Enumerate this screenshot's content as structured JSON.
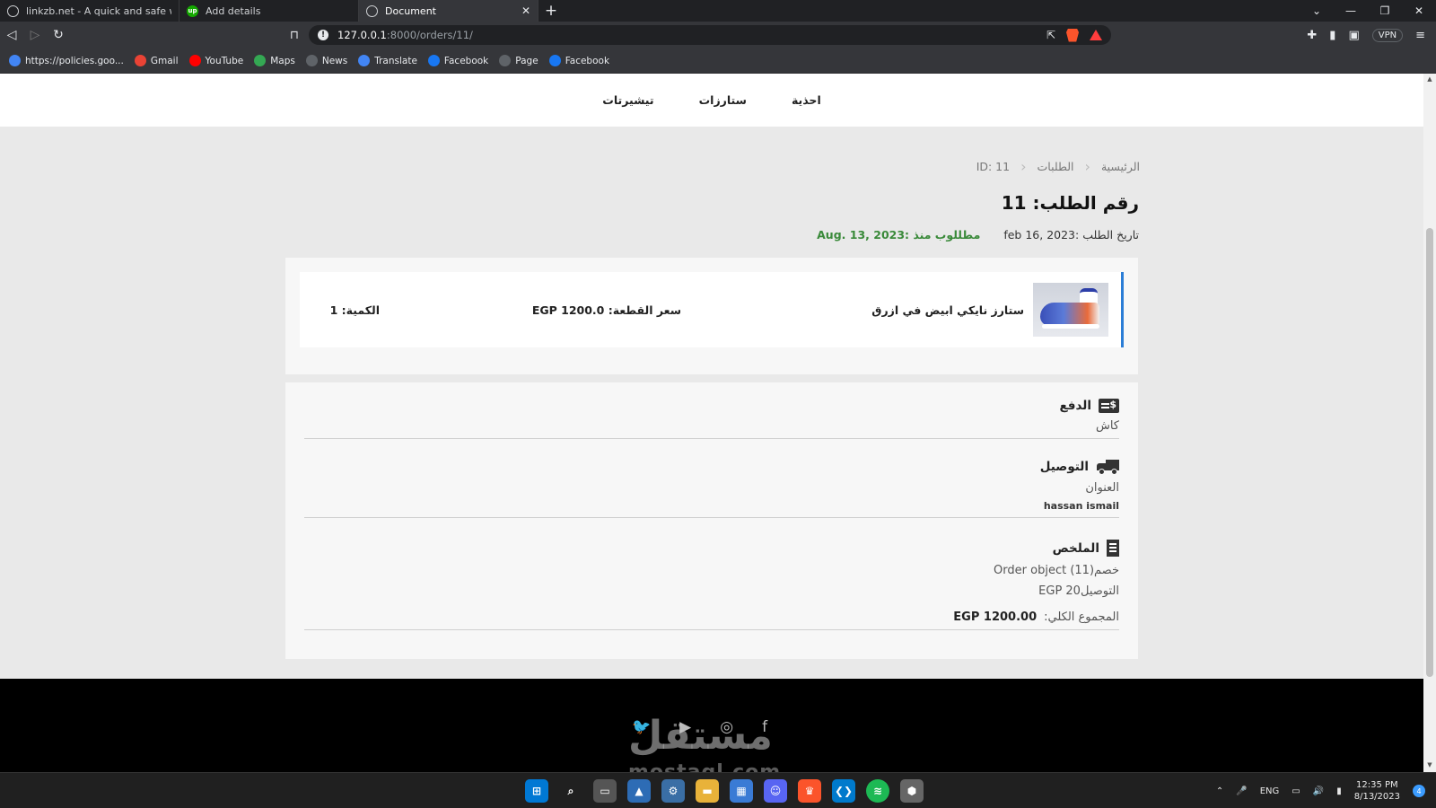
{
  "browser": {
    "tabs": [
      {
        "title": "linkzb.net - A quick and safe way to b",
        "active": false
      },
      {
        "title": "Add details",
        "active": false
      },
      {
        "title": "Document",
        "active": true
      }
    ],
    "url_host": "127.0.0.1",
    "url_path": ":8000/orders/11/",
    "vpn_label": "VPN",
    "bookmarks": [
      {
        "label": "https://policies.goo...",
        "icon": "google-icon",
        "color": "#4285f4"
      },
      {
        "label": "Gmail",
        "icon": "gmail-icon",
        "color": "#ea4335"
      },
      {
        "label": "YouTube",
        "icon": "youtube-icon",
        "color": "#ff0000"
      },
      {
        "label": "Maps",
        "icon": "maps-icon",
        "color": "#34a853"
      },
      {
        "label": "News",
        "icon": "globe-icon",
        "color": "#5f6368"
      },
      {
        "label": "Translate",
        "icon": "translate-icon",
        "color": "#4285f4"
      },
      {
        "label": "Facebook",
        "icon": "facebook-icon",
        "color": "#1877f2"
      },
      {
        "label": "Page",
        "icon": "globe-icon",
        "color": "#5f6368"
      },
      {
        "label": "Facebook",
        "icon": "facebook-icon",
        "color": "#1877f2"
      }
    ]
  },
  "nav": {
    "items": [
      "احذية",
      "ستارزات",
      "تيشيرتات"
    ]
  },
  "breadcrumb": {
    "home": "الرئيسية",
    "orders": "الطلبات",
    "current": "ID: 11"
  },
  "order": {
    "title": "رقم الطلب: 11",
    "date": "تاريخ الطلب :feb 16, 2023",
    "requested": "مطللوب منذ :Aug. 13, 2023"
  },
  "item": {
    "name": "ستارز نايكي ابيض في ازرق",
    "price": "سعر القطعة: EGP 1200.0",
    "quantity": "الكمية: 1"
  },
  "payment": {
    "title": "الدفع",
    "method": "كاش"
  },
  "shipping": {
    "title": "التوصيل",
    "address_label": "العنوان",
    "name": "hassan ismail"
  },
  "summary": {
    "title": "الملخص",
    "discount": "خصم(11) Order object",
    "delivery": "التوصيلEGP 20",
    "total_label": "المجموع الكلي:",
    "total_value": "EGP 1200.00"
  },
  "footer": {
    "watermark": "مستقل",
    "watermark_latin": "mostaql.com"
  },
  "taskbar": {
    "lang": "ENG",
    "time": "12:35 PM",
    "date": "8/13/2023",
    "notifications": "4"
  },
  "colors": {
    "accent_blue": "#2b7dd6",
    "requested_green": "#3a8a3a",
    "footer_bg": "#000000"
  }
}
